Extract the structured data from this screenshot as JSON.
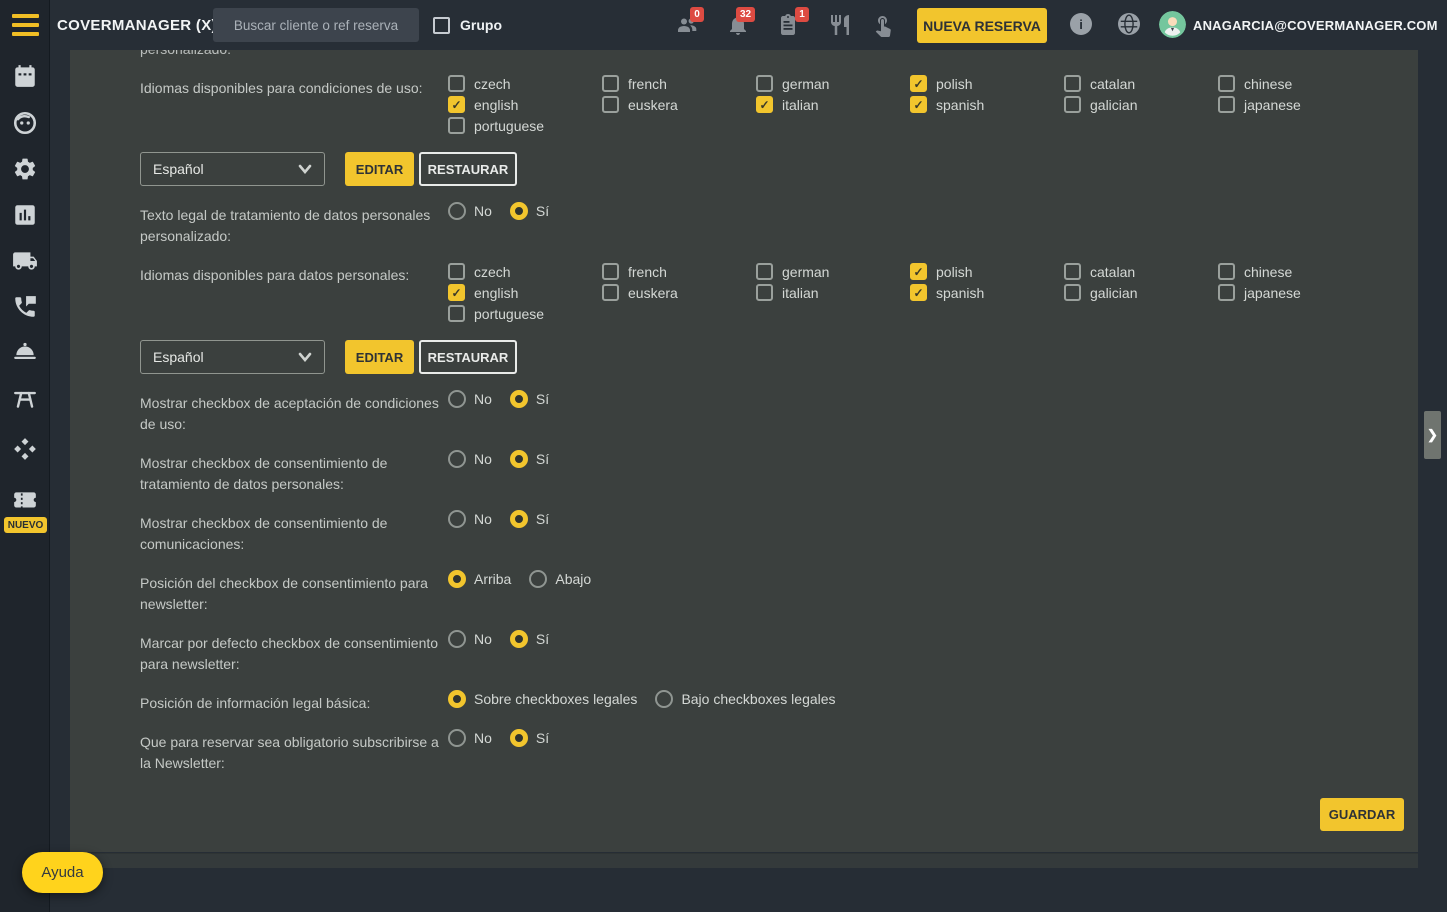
{
  "topbar": {
    "brand": "COVERMANAGER (X)",
    "search_placeholder": "Buscar cliente o ref reserva",
    "grupo_label": "Grupo",
    "badge_people": "0",
    "badge_bell": "32",
    "badge_list": "1",
    "new_reservation_label": "NUEVA RESERVA",
    "info_symbol": "i",
    "account_email": "ANAGARCIA@COVERMANAGER.COM"
  },
  "sidebar": {
    "nuevo_badge": "NUEVO"
  },
  "form": {
    "clipped_label": "personalizado:",
    "lang_cond": {
      "label": "Idiomas disponibles para condiciones de uso:",
      "cols": [
        {
          "items": [
            {
              "label": "czech",
              "checked": false
            },
            {
              "label": "english",
              "checked": true
            },
            {
              "label": "portuguese",
              "checked": false
            }
          ]
        },
        {
          "items": [
            {
              "label": "french",
              "checked": false
            },
            {
              "label": "euskera",
              "checked": false
            }
          ]
        },
        {
          "items": [
            {
              "label": "german",
              "checked": false
            },
            {
              "label": "italian",
              "checked": true
            }
          ]
        },
        {
          "items": [
            {
              "label": "polish",
              "checked": true
            },
            {
              "label": "spanish",
              "checked": true
            }
          ]
        },
        {
          "items": [
            {
              "label": "catalan",
              "checked": false
            },
            {
              "label": "galician",
              "checked": false
            }
          ]
        },
        {
          "items": [
            {
              "label": "chinese",
              "checked": false
            },
            {
              "label": "japanese",
              "checked": false
            }
          ]
        }
      ]
    },
    "editor1": {
      "value": "Español",
      "edit_label": "EDITAR",
      "restore_label": "RESTAURAR"
    },
    "texto_legal": {
      "label": "Texto legal de tratamiento de datos personales personalizado:",
      "options": [
        {
          "label": "No",
          "selected": false
        },
        {
          "label": "Sí",
          "selected": true
        }
      ]
    },
    "lang_datos": {
      "label": "Idiomas disponibles para datos personales:",
      "cols": [
        {
          "items": [
            {
              "label": "czech",
              "checked": false
            },
            {
              "label": "english",
              "checked": true
            },
            {
              "label": "portuguese",
              "checked": false
            }
          ]
        },
        {
          "items": [
            {
              "label": "french",
              "checked": false
            },
            {
              "label": "euskera",
              "checked": false
            }
          ]
        },
        {
          "items": [
            {
              "label": "german",
              "checked": false
            },
            {
              "label": "italian",
              "checked": false
            }
          ]
        },
        {
          "items": [
            {
              "label": "polish",
              "checked": true
            },
            {
              "label": "spanish",
              "checked": true
            }
          ]
        },
        {
          "items": [
            {
              "label": "catalan",
              "checked": false
            },
            {
              "label": "galician",
              "checked": false
            }
          ]
        },
        {
          "items": [
            {
              "label": "chinese",
              "checked": false
            },
            {
              "label": "japanese",
              "checked": false
            }
          ]
        }
      ]
    },
    "editor2": {
      "value": "Español",
      "edit_label": "EDITAR",
      "restore_label": "RESTAURAR"
    },
    "radio_rows": [
      {
        "label": "Mostrar checkbox de aceptación de condiciones de uso:",
        "options": [
          {
            "label": "No",
            "selected": false
          },
          {
            "label": "Sí",
            "selected": true
          }
        ]
      },
      {
        "label": "Mostrar checkbox de consentimiento de tratamiento de datos personales:",
        "options": [
          {
            "label": "No",
            "selected": false
          },
          {
            "label": "Sí",
            "selected": true
          }
        ]
      },
      {
        "label": "Mostrar checkbox de consentimiento de comunicaciones:",
        "options": [
          {
            "label": "No",
            "selected": false
          },
          {
            "label": "Sí",
            "selected": true
          }
        ]
      },
      {
        "label": "Posición del checkbox de consentimiento para newsletter:",
        "options": [
          {
            "label": "Arriba",
            "selected": true
          },
          {
            "label": "Abajo",
            "selected": false
          }
        ]
      },
      {
        "label": "Marcar por defecto checkbox de consentimiento para newsletter:",
        "options": [
          {
            "label": "No",
            "selected": false
          },
          {
            "label": "Sí",
            "selected": true
          }
        ]
      },
      {
        "label": "Posición de información legal básica:",
        "options": [
          {
            "label": "Sobre checkboxes legales",
            "selected": true
          },
          {
            "label": "Bajo checkboxes legales",
            "selected": false
          }
        ]
      },
      {
        "label": "Que para reservar sea obligatorio subscribirse a la Newsletter:",
        "options": [
          {
            "label": "No",
            "selected": false
          },
          {
            "label": "Sí",
            "selected": true
          }
        ]
      }
    ],
    "save_label": "GUARDAR"
  },
  "help_label": "Ayuda",
  "colors": {
    "accent": "#F2C52D",
    "badge_red": "#DD4B42",
    "help_yellow": "#FFD31C",
    "card_bg": "#3B403E",
    "topbar_bg": "#272E36",
    "sidebar_bg": "#1F252C"
  }
}
